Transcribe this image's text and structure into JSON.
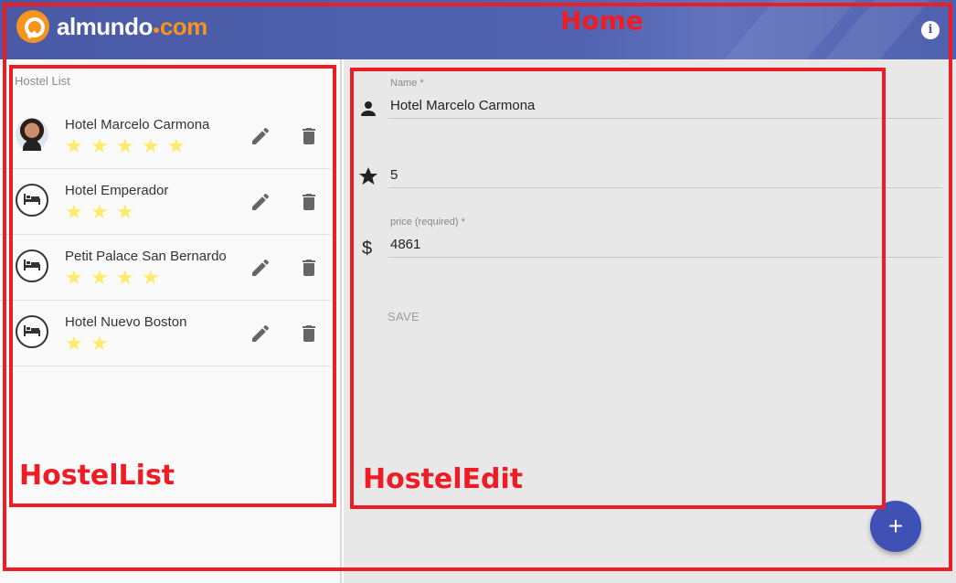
{
  "header": {
    "logo_text_main": "almundo",
    "logo_text_accent": "com",
    "info_icon": "info-icon",
    "brand_color": "#4a5aa6",
    "accent_color": "#f7941d"
  },
  "hostel_list": {
    "header": "Hostel List",
    "items": [
      {
        "name": "Hotel Marcelo Carmona",
        "stars": 5,
        "avatar": "photo"
      },
      {
        "name": "Hotel Emperador",
        "stars": 3,
        "avatar": "hotel-bed-icon"
      },
      {
        "name": "Petit Palace San Bernardo",
        "stars": 4,
        "avatar": "hotel-bed-icon"
      },
      {
        "name": "Hotel Nuevo Boston",
        "stars": 2,
        "avatar": "hotel-bed-icon"
      }
    ],
    "star_color": "#ffeb6b"
  },
  "hostel_edit": {
    "name_label": "Name *",
    "name_value": "Hotel Marcelo Carmona",
    "stars_value": "5",
    "price_label": "price (required) *",
    "price_value": "4861",
    "save_label": "SAVE"
  },
  "fab": {
    "label": "+"
  },
  "annotations": {
    "home": "Home",
    "hostel_list": "HostelList",
    "hostel_edit": "HostelEdit",
    "color": "#ee1c25"
  }
}
